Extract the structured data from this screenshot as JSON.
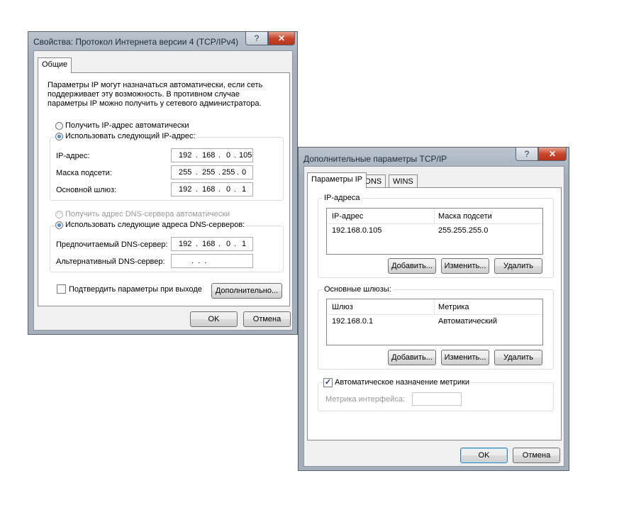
{
  "dialog1": {
    "title": "Свойства: Протокол Интернета версии 4 (TCP/IPv4)",
    "help": "?",
    "close": "✕",
    "tab": "Общие",
    "intro": "Параметры IP могут назначаться автоматически, если сеть поддерживает эту возможность. В противном случае параметры IP можно получить у сетевого администратора.",
    "radio_auto_ip": "Получить IP-адрес автоматически",
    "radio_manual_ip": "Использовать следующий IP-адрес:",
    "ip_label": "IP-адрес:",
    "ip": [
      "192",
      "168",
      "0",
      "105"
    ],
    "mask_label": "Маска подсети:",
    "mask": [
      "255",
      "255",
      "255",
      "0"
    ],
    "gateway_label": "Основной шлюз:",
    "gateway": [
      "192",
      "168",
      "0",
      "1"
    ],
    "radio_auto_dns": "Получить адрес DNS-сервера автоматически",
    "radio_manual_dns": "Использовать следующие адреса DNS-серверов:",
    "dns1_label": "Предпочитаемый DNS-сервер:",
    "dns1": [
      "192",
      "168",
      "0",
      "1"
    ],
    "dns2_label": "Альтернативный DNS-сервер:",
    "dns2_dots": ".  .  .",
    "validate_label": "Подтвердить параметры при выходе",
    "advanced_button": "Дополнительно...",
    "ok": "OK",
    "cancel": "Отмена"
  },
  "dialog2": {
    "title": "Дополнительные параметры TCP/IP",
    "help": "?",
    "close": "✕",
    "tabs": [
      "Параметры IP",
      "DNS",
      "WINS"
    ],
    "ip_group_label": "IP-адреса",
    "ip_table": {
      "headers": [
        "IP-адрес",
        "Маска подсети"
      ],
      "rows": [
        [
          "192.168.0.105",
          "255.255.255.0"
        ]
      ]
    },
    "ip_buttons": [
      "Добавить...",
      "Изменить...",
      "Удалить"
    ],
    "gw_group_label": "Основные шлюзы:",
    "gw_table": {
      "headers": [
        "Шлюз",
        "Метрика"
      ],
      "rows": [
        [
          "192.168.0.1",
          "Автоматический"
        ]
      ]
    },
    "gw_buttons": [
      "Добавить...",
      "Изменить...",
      "Удалить"
    ],
    "auto_metric_label": "Автоматическое назначение метрики",
    "auto_metric_checked": true,
    "interface_metric_label": "Метрика интерфейса:",
    "ok": "OK",
    "cancel": "Отмена"
  }
}
